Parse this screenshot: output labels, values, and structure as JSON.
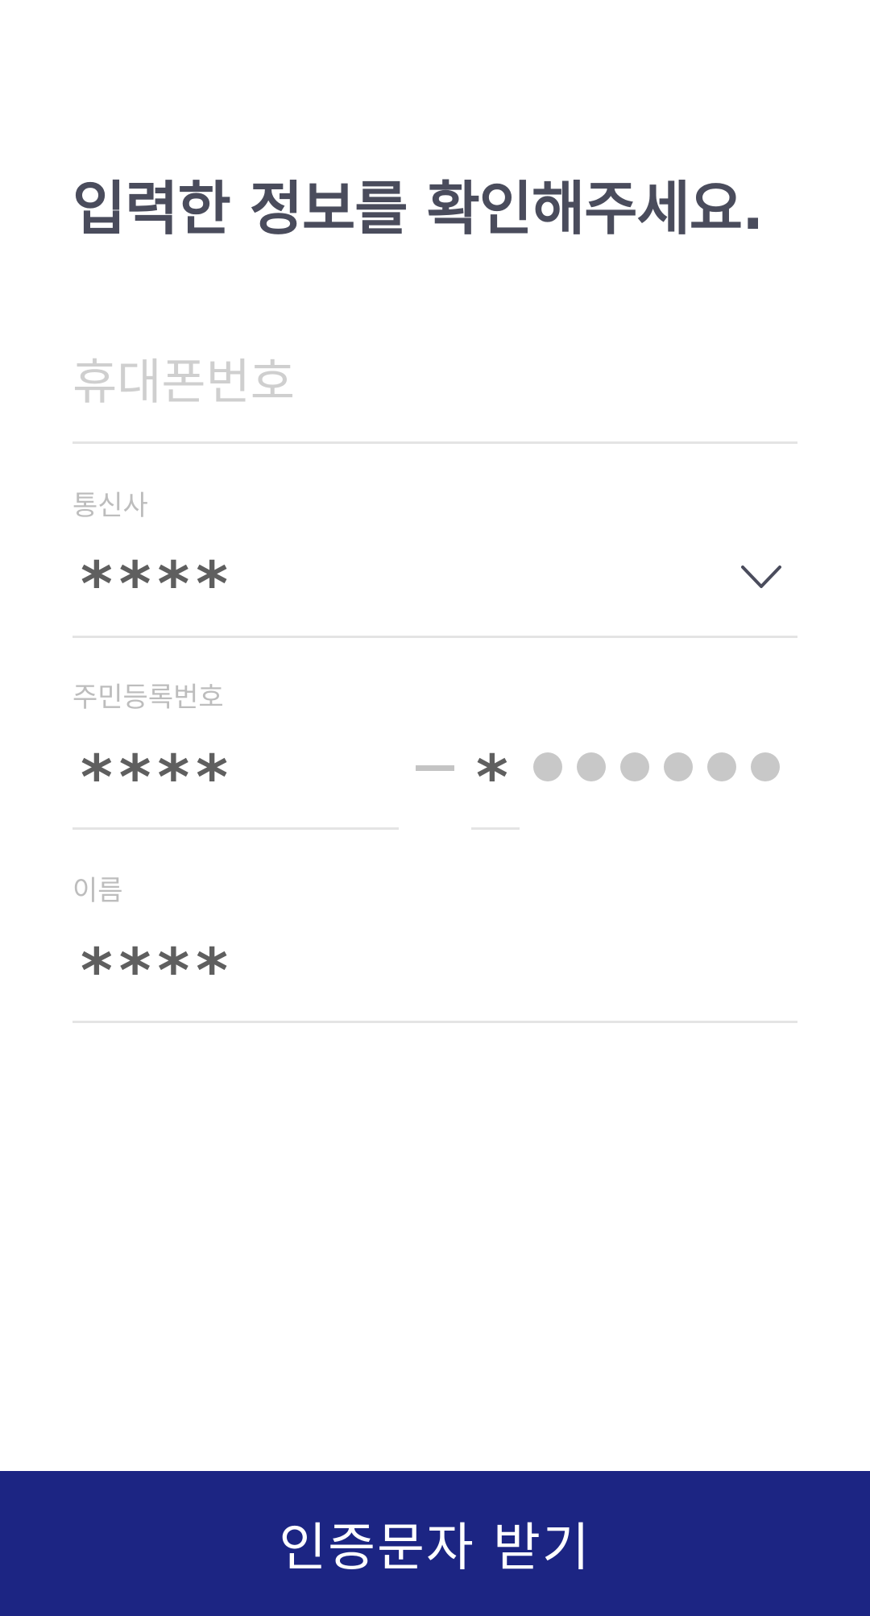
{
  "header": {
    "title": "입력한 정보를 확인해주세요."
  },
  "form": {
    "phone": {
      "placeholder": "휴대폰번호",
      "value": ""
    },
    "carrier": {
      "label": "통신사",
      "value": "****",
      "icon": "chevron-down-icon"
    },
    "resident_number": {
      "label": "주민등록번호",
      "front_value": "****",
      "back_first_value": "*",
      "hidden_digit_count": 6
    },
    "name": {
      "label": "이름",
      "value": "****"
    }
  },
  "footer": {
    "submit_label": "인증문자 받기"
  },
  "colors": {
    "primary": "#1c2583",
    "title_text": "#4a4c5c",
    "label_text": "#bdbdbd",
    "masked_text": "#5f5f5f",
    "divider": "#e4e4e4"
  }
}
